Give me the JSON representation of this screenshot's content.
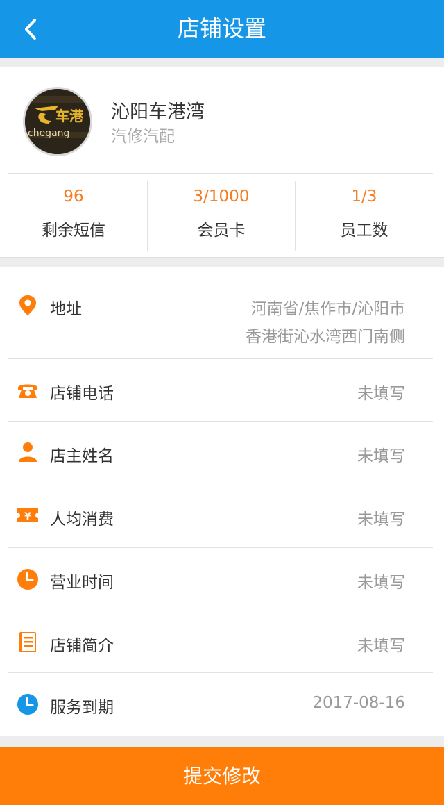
{
  "header": {
    "title": "店铺设置"
  },
  "shop": {
    "name": "沁阳车港湾",
    "type": "汽修汽配",
    "logo_text": "chegang"
  },
  "stats": [
    {
      "value": "96",
      "label": "剩余短信"
    },
    {
      "value": "3/1000",
      "label": "会员卡"
    },
    {
      "value": "1/3",
      "label": "员工数"
    }
  ],
  "fields": [
    {
      "icon": "location-pin-icon",
      "label": "地址",
      "value_line1": "河南省/焦作市/沁阳市",
      "value_line2": "香港街沁水湾西门南侧"
    },
    {
      "icon": "telephone-icon",
      "label": "店铺电话",
      "value": "未填写"
    },
    {
      "icon": "person-icon",
      "label": "店主姓名",
      "value": "未填写"
    },
    {
      "icon": "yen-ticket-icon",
      "label": "人均消费",
      "value": "未填写"
    },
    {
      "icon": "clock-icon",
      "label": "营业时间",
      "value": "未填写"
    },
    {
      "icon": "document-icon",
      "label": "店铺简介",
      "value": "未填写"
    },
    {
      "icon": "clock-icon",
      "label": "服务到期",
      "value": "2017-08-16"
    }
  ],
  "colors": {
    "header": "#1596e6",
    "accent": "#ff7e0a",
    "stat_value": "#f57c1f",
    "expiry_icon": "#1596e6"
  },
  "submit_label": "提交修改"
}
